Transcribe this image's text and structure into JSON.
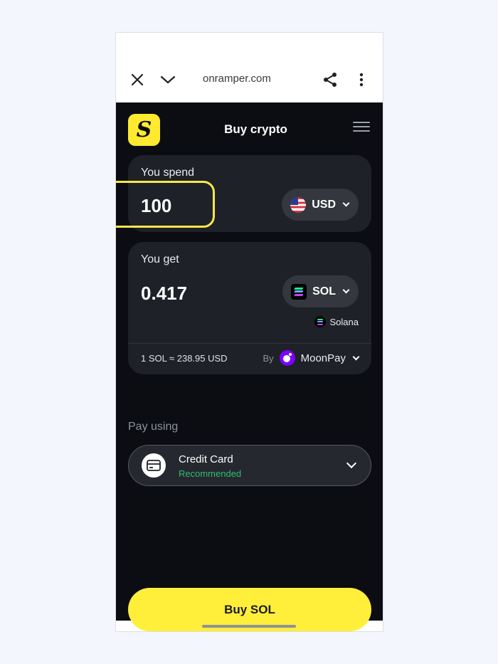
{
  "browser": {
    "url": "onramper.com",
    "close_icon": "close-icon",
    "tabs_icon": "chevron-down-icon",
    "share_icon": "share-icon",
    "more_icon": "more-vertical-icon"
  },
  "app": {
    "title": "Buy crypto",
    "logo_letter": "S",
    "menu_icon": "hamburger-menu-icon"
  },
  "spend": {
    "label": "You spend",
    "amount": "100",
    "currency": "USD",
    "currency_icon": "us-flag-icon"
  },
  "get": {
    "label": "You get",
    "amount": "0.417",
    "currency": "SOL",
    "currency_icon": "solana-icon",
    "network": "Solana"
  },
  "quote": {
    "rate": "1 SOL ≈ 238.95 USD",
    "by_label": "By",
    "provider": "MoonPay",
    "provider_icon": "moonpay-icon"
  },
  "payment": {
    "label": "Pay using",
    "method": "Credit Card",
    "badge": "Recommended",
    "badge_color": "#2fbf71"
  },
  "cta": {
    "label": "Buy SOL",
    "color": "#ffee3a"
  },
  "colors": {
    "app_bg": "#0b0d12",
    "card_bg": "#1e2127",
    "highlight": "#fce64a",
    "page_bg": "#f3f6fc"
  }
}
